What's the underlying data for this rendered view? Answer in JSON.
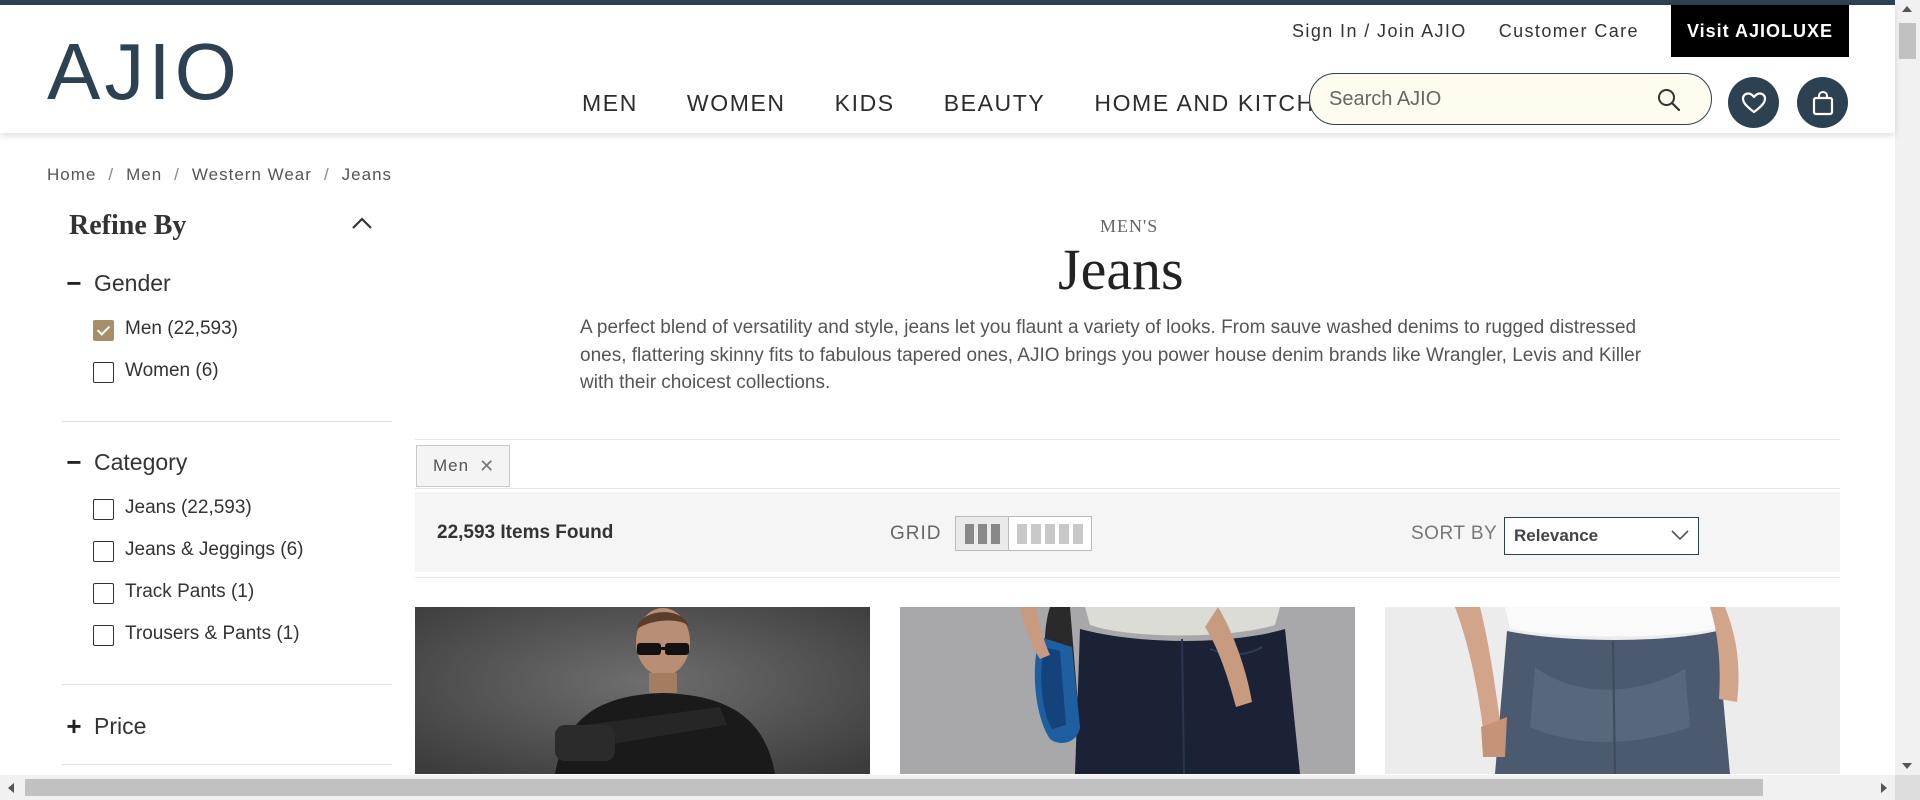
{
  "brand": {
    "logo_text": "AJIO",
    "accent": "#2c4152",
    "luxe_bg": "#000000",
    "checkbox_checked": "#a68f68"
  },
  "header": {
    "top_links": [
      "Sign In / Join AJIO",
      "Customer Care"
    ],
    "luxe_button": "Visit AJIOLUXE",
    "nav": [
      "MEN",
      "WOMEN",
      "KIDS",
      "BEAUTY",
      "HOME AND KITCHEN"
    ],
    "search_placeholder": "Search AJIO",
    "icons": [
      "search-icon",
      "heart-icon",
      "bag-icon"
    ]
  },
  "breadcrumb": [
    "Home",
    "Men",
    "Western Wear",
    "Jeans"
  ],
  "sidebar": {
    "title": "Refine By",
    "facets": [
      {
        "label": "Gender",
        "expanded": true,
        "options": [
          {
            "label": "Men (22,593)",
            "checked": true
          },
          {
            "label": "Women (6)",
            "checked": false
          }
        ]
      },
      {
        "label": "Category",
        "expanded": true,
        "options": [
          {
            "label": "Jeans (22,593)",
            "checked": false
          },
          {
            "label": "Jeans & Jeggings (6)",
            "checked": false
          },
          {
            "label": "Track Pants (1)",
            "checked": false
          },
          {
            "label": "Trousers & Pants (1)",
            "checked": false
          }
        ]
      },
      {
        "label": "Price",
        "expanded": false,
        "options": []
      }
    ]
  },
  "main": {
    "prefix": "MEN'S",
    "title": "Jeans",
    "description": "A perfect blend of versatility and style, jeans let you flaunt a variety of looks. From sauve washed denims to rugged distressed ones, flattering skinny fits to fabulous tapered ones, AJIO brings you power house denim brands like Wrangler, Levis and Killer with their choicest collections.",
    "active_filters": [
      "Men"
    ],
    "items_found": "22,593 Items Found",
    "grid_label": "GRID",
    "grid_options": [
      3,
      5
    ],
    "grid_selected": 3,
    "sort_label": "SORT BY",
    "sort_value": "Relevance"
  }
}
